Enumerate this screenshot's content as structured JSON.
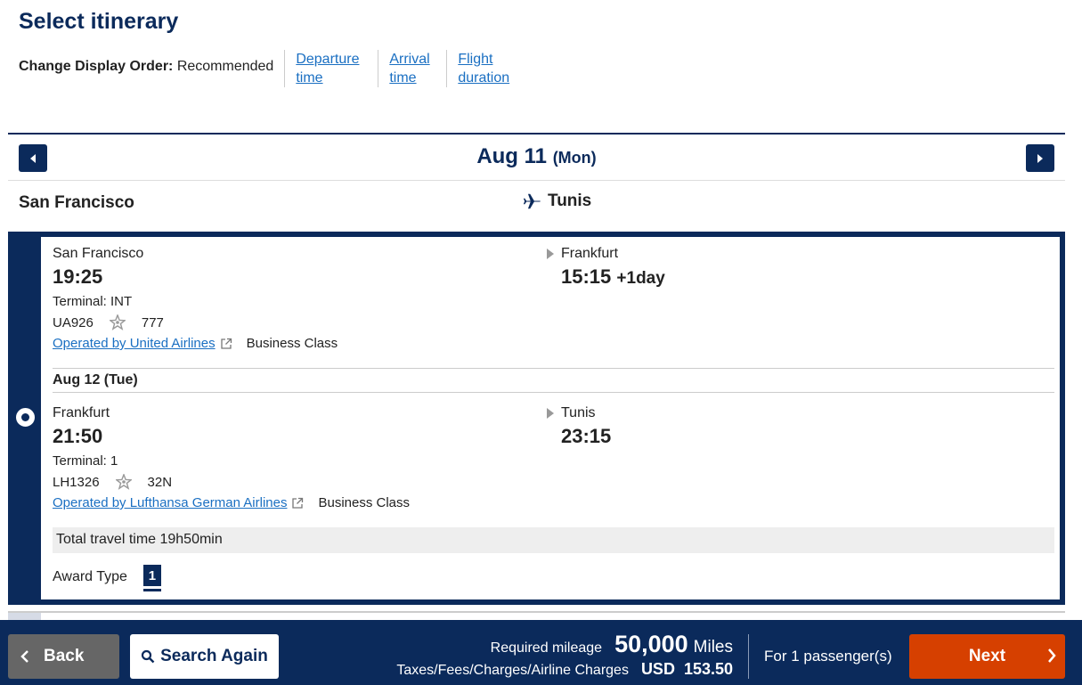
{
  "page": {
    "title": "Select itinerary"
  },
  "display_order": {
    "label": "Change Display Order:",
    "current": "Recommended",
    "links": [
      {
        "line1": "Departure",
        "line2": "time"
      },
      {
        "line1": "Arrival",
        "line2": "time"
      },
      {
        "line1": "Flight",
        "line2": "duration"
      }
    ]
  },
  "date_bar": {
    "date": "Aug 11",
    "dow": "(Mon)"
  },
  "route": {
    "from": "San Francisco",
    "to": "Tunis"
  },
  "itinerary": {
    "segments": [
      {
        "dep_city": "San Francisco",
        "dep_time": "19:25",
        "arr_city": "Frankfurt",
        "arr_time": "15:15",
        "arr_plus": "+1day",
        "terminal": "Terminal: INT",
        "flight": "UA926",
        "aircraft": "777",
        "operated_by": "Operated by United Airlines",
        "cabin": "Business Class"
      },
      {
        "dep_city": "Frankfurt",
        "dep_time": "21:50",
        "arr_city": "Tunis",
        "arr_time": "23:15",
        "terminal": "Terminal: 1",
        "flight": "LH1326",
        "aircraft": "32N",
        "operated_by": "Operated by Lufthansa German Airlines",
        "cabin": "Business Class"
      }
    ],
    "connection_date": "Aug 12 (Tue)",
    "total_time": "Total travel time 19h50min",
    "award_type_label": "Award Type",
    "award_type_value": "1"
  },
  "footer": {
    "back_label": "Back",
    "search_label": "Search Again",
    "miles_label": "Required mileage",
    "miles_value": "50,000",
    "miles_unit": "Miles",
    "tax_label": "Taxes/Fees/Charges/Airline Charges",
    "tax_value": "USD  153.50",
    "passengers": "For 1 passenger(s)",
    "next_label": "Next"
  },
  "colors": {
    "navy": "#0b2a5b",
    "link": "#1a6fc2",
    "next": "#d64000",
    "back": "#666666"
  }
}
